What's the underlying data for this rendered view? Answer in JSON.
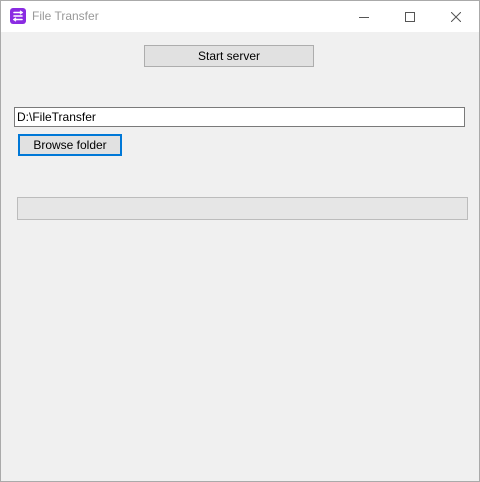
{
  "window": {
    "title": "File Transfer",
    "icon": "file-transfer-app-icon"
  },
  "main": {
    "start_server_label": "Start server",
    "folder_path_value": "D:\\FileTransfer",
    "browse_folder_label": "Browse folder",
    "progress_fraction": 0
  },
  "colors": {
    "accent": "#0078d7",
    "app_icon": "#8a2be2",
    "progress_fill": "#06b025"
  }
}
